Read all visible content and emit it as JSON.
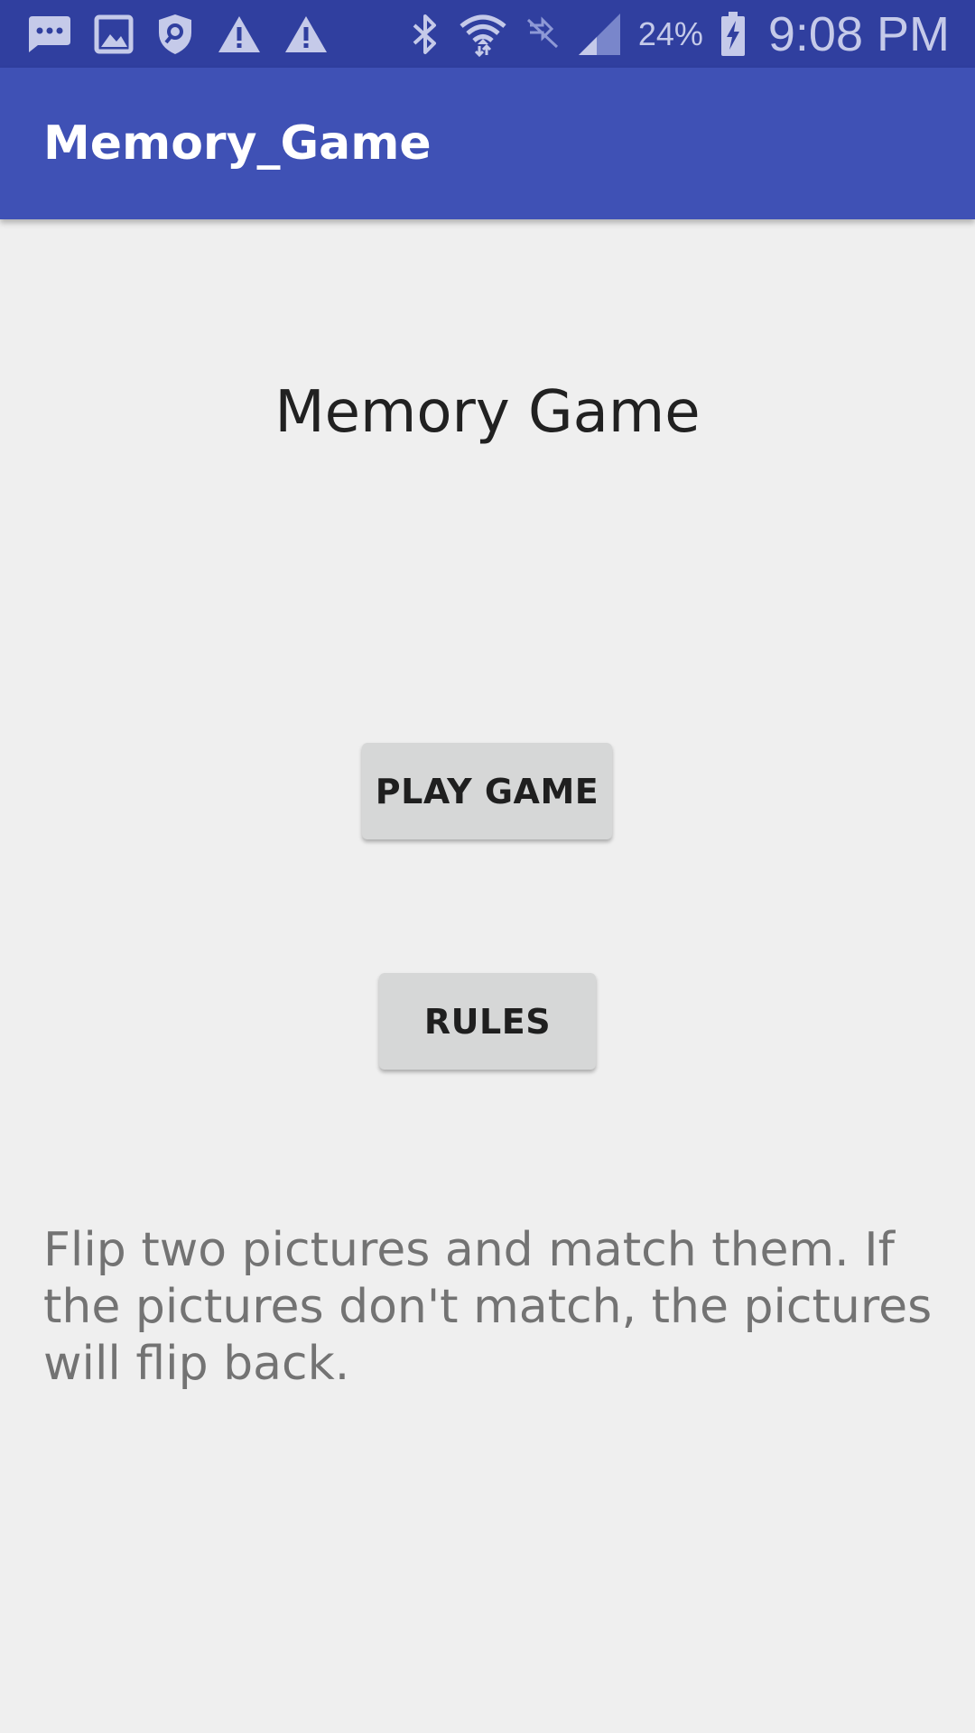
{
  "status_bar": {
    "icons_left": [
      "chat-bubble-icon",
      "image-icon",
      "shield-search-icon",
      "warning-icon",
      "warning-icon"
    ],
    "icons_right": [
      "bluetooth-icon",
      "wifi-icon",
      "data-off-icon",
      "signal-icon",
      "battery-charging-icon"
    ],
    "battery_percent": "24%",
    "time": "9:08 PM",
    "color": "#c5cae9",
    "background": "#303f9f"
  },
  "app_bar": {
    "title": "Memory_Game",
    "background": "#3f51b5"
  },
  "main": {
    "heading": "Memory Game",
    "play_button_label": "PLAY GAME",
    "rules_button_label": "RULES",
    "rules_text": "Flip two pictures and match them. If the pictures don't match, the pictures will flip back."
  }
}
